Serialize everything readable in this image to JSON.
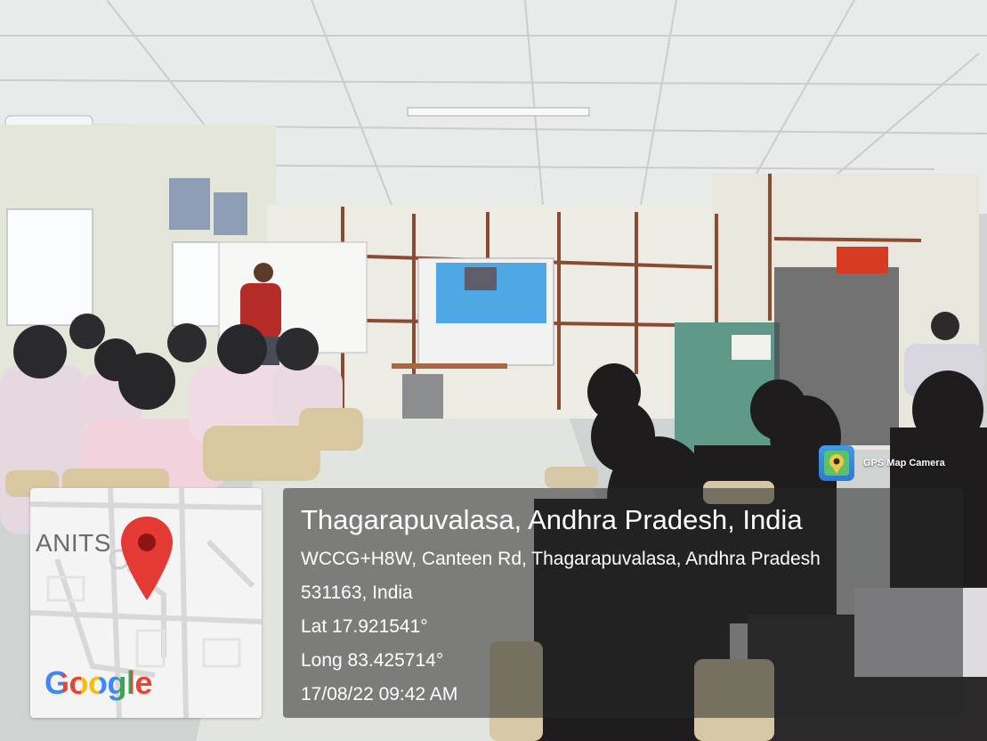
{
  "photo": {
    "scene": "classroom-lecture-with-projector"
  },
  "map_thumbnail": {
    "place_label": "ANITS",
    "logo_text": "Google",
    "logo_colors": [
      "#4285F4",
      "#EA4335",
      "#FBBC05",
      "#4285F4",
      "#34A853",
      "#EA4335"
    ],
    "pin_color": "#E53935"
  },
  "overlay": {
    "app_name": "GPS Map Camera",
    "app_icon": "gps-map-camera-icon",
    "location_title": "Thagarapuvalasa, Andhra Pradesh, India",
    "address_line1": "WCCG+H8W, Canteen Rd, Thagarapuvalasa, Andhra Pradesh",
    "address_line2": "531163, India",
    "latitude": "Lat 17.921541°",
    "longitude": "Long 83.425714°",
    "timestamp": "17/08/22 09:42 AM"
  }
}
